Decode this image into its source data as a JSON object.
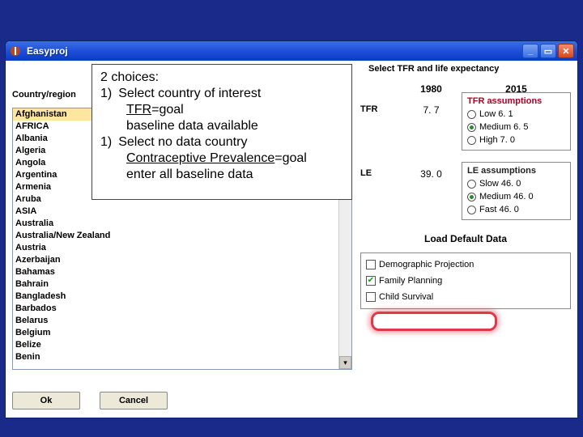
{
  "titlebar": {
    "app": "Easyproj"
  },
  "labels": {
    "country_region": "Country/region",
    "select_tfr_le": "Select TFR and life expectancy",
    "year1": "1980",
    "year2": "2015",
    "tfr": "TFR",
    "le": "LE",
    "tfr_value": "7. 7",
    "le_value": "39. 0",
    "tfr_assumptions": "TFR assumptions",
    "le_assumptions": "LE assumptions",
    "load_default": "Load Default Data"
  },
  "buttons": {
    "ok": "Ok",
    "cancel": "Cancel"
  },
  "tfr_options": [
    {
      "label": "Low 6. 1",
      "checked": false
    },
    {
      "label": "Medium 6. 5",
      "checked": true
    },
    {
      "label": "High 7. 0",
      "checked": false
    }
  ],
  "le_options": [
    {
      "label": "Slow 46. 0",
      "checked": false
    },
    {
      "label": "Medium 46. 0",
      "checked": true
    },
    {
      "label": "Fast 46. 0",
      "checked": false
    }
  ],
  "projections": [
    {
      "label": "Demographic Projection",
      "checked": false
    },
    {
      "label": "Family Planning",
      "checked": true
    },
    {
      "label": "Child Survival",
      "checked": false
    }
  ],
  "countries": [
    "Afghanistan",
    "AFRICA",
    "Albania",
    "Algeria",
    "Angola",
    "Argentina",
    "Armenia",
    "Aruba",
    "ASIA",
    "Australia",
    "Australia/New Zealand",
    "Austria",
    "Azerbaijan",
    "Bahamas",
    "Bahrain",
    "Bangladesh",
    "Barbados",
    "Belarus",
    "Belgium",
    "Belize",
    "Benin"
  ],
  "selected_country_index": 0,
  "callout": {
    "head": "2 choices:",
    "l1a": "1)",
    "l1b": "Select country of interest",
    "l2a": "TFR",
    "l2b": "=goal",
    "l3": "baseline data available",
    "l4a": "1)",
    "l4b": "Select no data country",
    "l5a": "Contraceptive Prevalence",
    "l5b": "=goal",
    "l6": "enter all baseline data"
  }
}
